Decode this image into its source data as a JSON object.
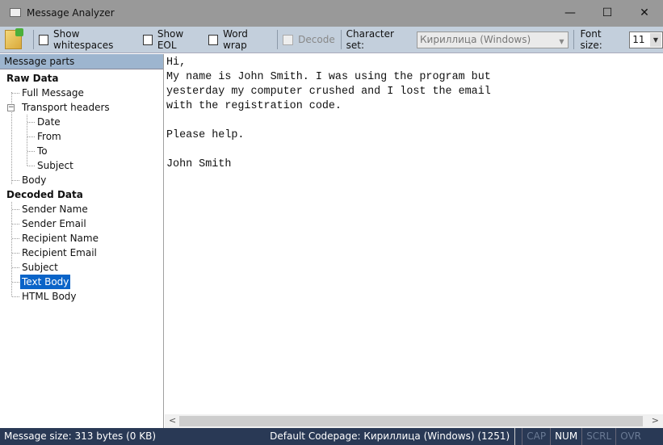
{
  "window": {
    "title": "Message Analyzer",
    "minimize": "—",
    "maximize": "☐",
    "close": "✕"
  },
  "toolbar": {
    "show_whitespaces": "Show whitespaces",
    "show_eol": "Show EOL",
    "word_wrap": "Word wrap",
    "decode": "Decode",
    "charset_label": "Character set:",
    "charset_value": "Кириллица (Windows)",
    "fontsize_label": "Font size:",
    "fontsize_value": "11"
  },
  "tree": {
    "header": "Message parts",
    "raw": "Raw Data",
    "full": "Full Message",
    "transport": "Transport headers",
    "date": "Date",
    "from": "From",
    "to": "To",
    "subject": "Subject",
    "body": "Body",
    "decoded": "Decoded Data",
    "sender_name": "Sender Name",
    "sender_email": "Sender Email",
    "recipient_name": "Recipient Name",
    "recipient_email": "Recipient Email",
    "d_subject": "Subject",
    "text_body": "Text Body",
    "html_body": "HTML Body",
    "selected": "Text Body"
  },
  "content": {
    "text": "Hi,\nMy name is John Smith. I was using the program but\nyesterday my computer crushed and I lost the email\nwith the registration code.\n\nPlease help.\n\nJohn Smith"
  },
  "status": {
    "size": "Message size: 313 bytes (0 KB)",
    "codepage": "Default Codepage: Кириллица (Windows) (1251)",
    "cap": "CAP",
    "num": "NUM",
    "scrl": "SCRL",
    "ovr": "OVR"
  },
  "colors": {
    "status_bg": "#293955",
    "selection": "#0a64c8",
    "toolbar_bg": "#c3cfdc"
  }
}
